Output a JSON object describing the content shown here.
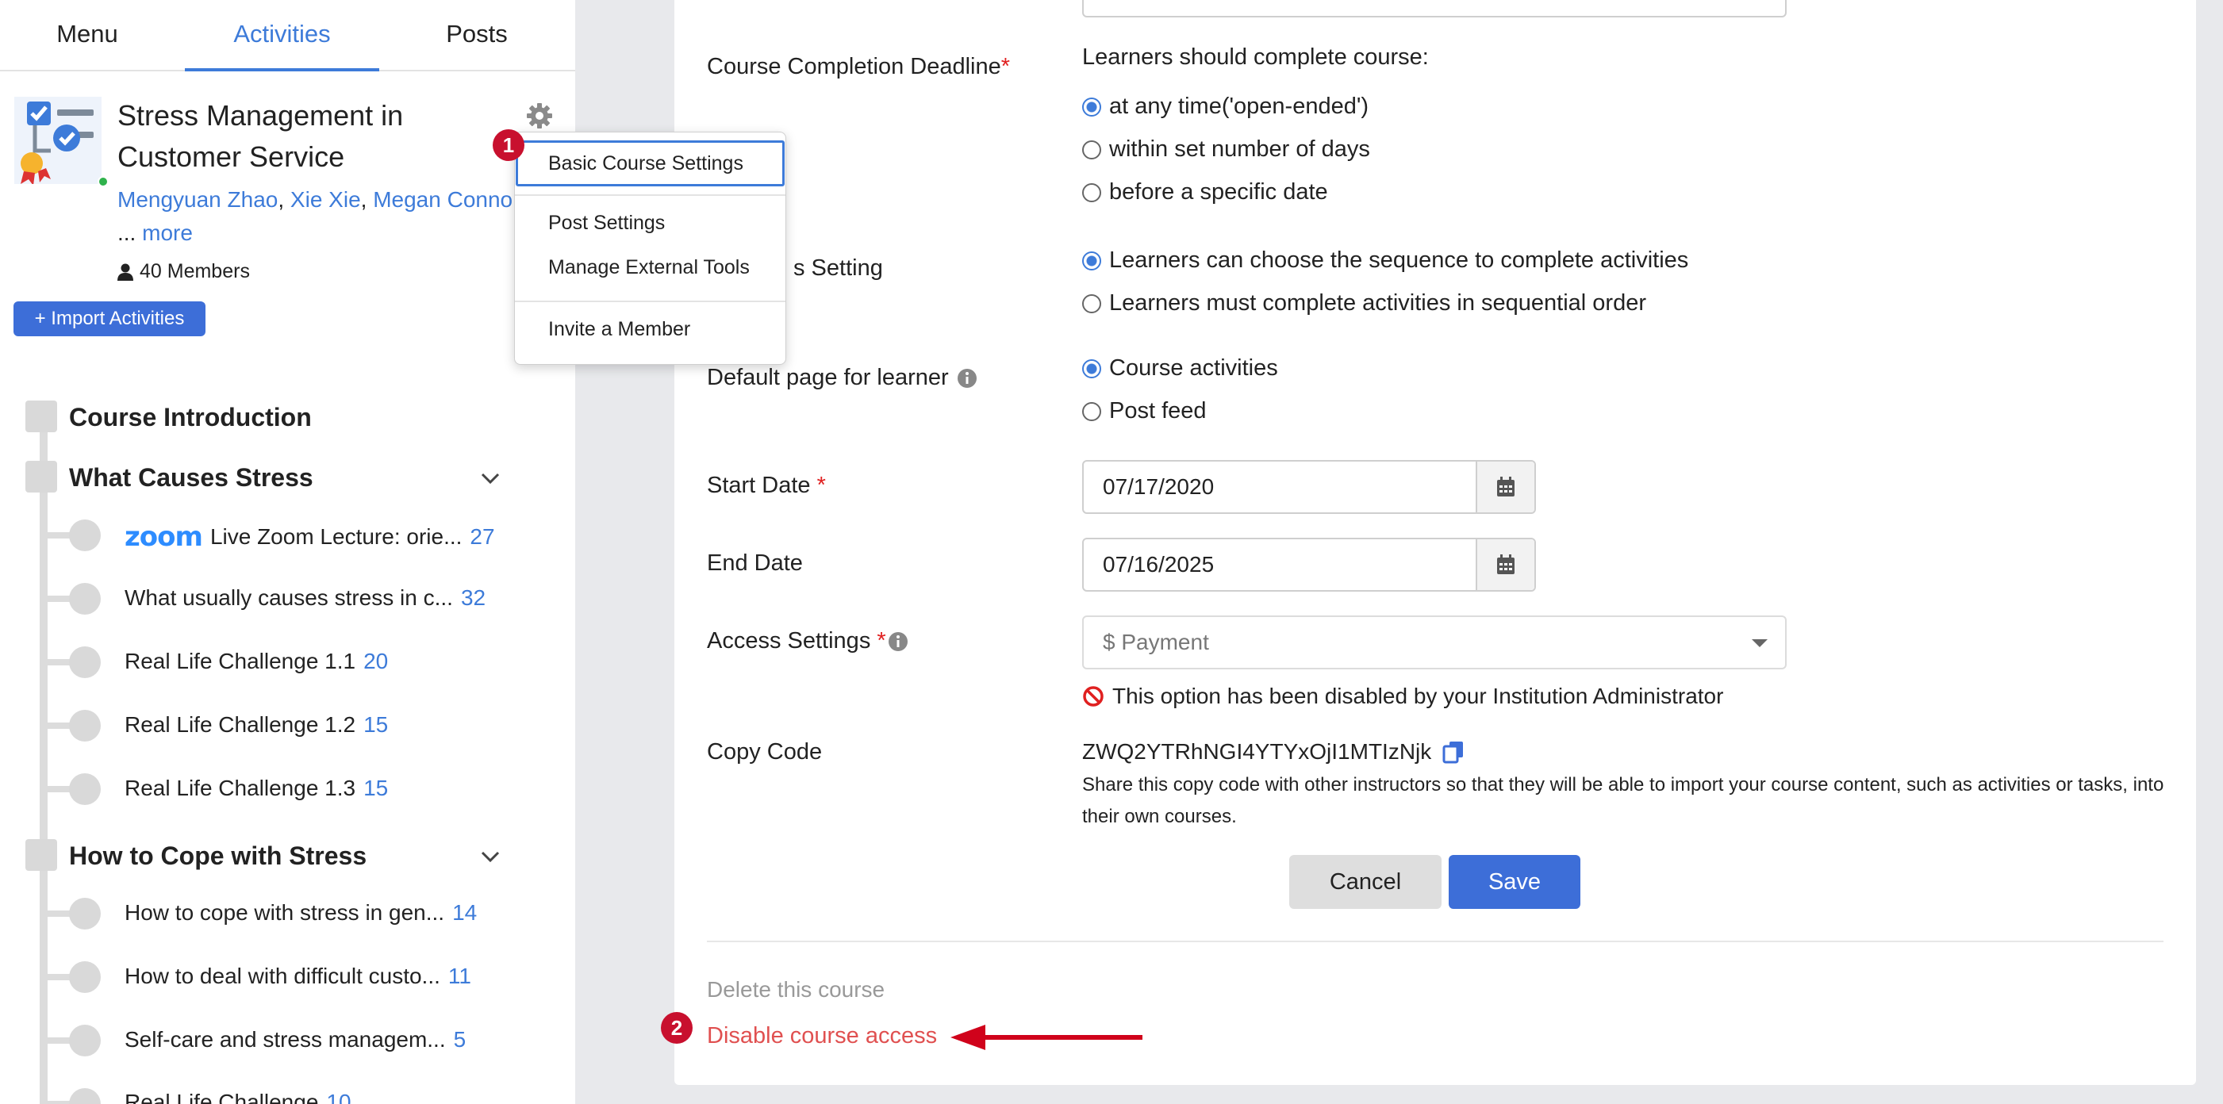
{
  "tabs": [
    {
      "label": "Menu"
    },
    {
      "label": "Activities"
    },
    {
      "label": "Posts"
    }
  ],
  "course": {
    "title": "Stress Management in Customer Service",
    "instructors": [
      "Mengyuan Zhao",
      "Xie Xie",
      "Megan Conno"
    ],
    "ellipsis": "...",
    "more_label": "more",
    "members_label": "40 Members"
  },
  "import_button": {
    "label": "+ Import Activities"
  },
  "outline": {
    "sections": [
      {
        "title": "Course Introduction"
      },
      {
        "title": "What Causes Stress"
      },
      {
        "title": "How to Cope with Stress"
      }
    ],
    "items": [
      {
        "logo": "zoom",
        "label": "Live Zoom Lecture: orie...",
        "count": "27"
      },
      {
        "label": "What usually causes stress in c...",
        "count": "32"
      },
      {
        "label": "Real Life Challenge 1.1",
        "count": "20"
      },
      {
        "label": "Real Life Challenge 1.2",
        "count": "15"
      },
      {
        "label": "Real Life Challenge 1.3",
        "count": "15"
      },
      {
        "label": "How to cope with stress in gen...",
        "count": "14"
      },
      {
        "label": "How to deal with difficult custo...",
        "count": "11"
      },
      {
        "label": "Self-care and stress managem...",
        "count": "5"
      },
      {
        "label": "Real Life Challenge",
        "count": "10"
      }
    ]
  },
  "menu": {
    "items": [
      {
        "label": "Basic Course Settings"
      },
      {
        "label": "Post Settings"
      },
      {
        "label": "Manage External Tools"
      },
      {
        "label": "Invite a Member"
      }
    ]
  },
  "badges": [
    "1",
    "2"
  ],
  "settings": {
    "completion_label": "Course Completion Deadline",
    "required_mark": "*",
    "completion_intro": "Learners should complete course:",
    "completion_options": [
      {
        "label": "at any time('open-ended')",
        "selected": true
      },
      {
        "label": "within set number of days",
        "selected": false
      },
      {
        "label": "before a specific date",
        "selected": false
      }
    ],
    "sequence_label_partial": "s Setting",
    "sequence_options": [
      {
        "label": "Learners can choose the sequence to complete activities",
        "selected": true
      },
      {
        "label": "Learners must complete activities in sequential order",
        "selected": false
      }
    ],
    "default_page_label": "Default page for learner",
    "default_page_options": [
      {
        "label": "Course activities",
        "selected": true
      },
      {
        "label": "Post feed",
        "selected": false
      }
    ],
    "start_date_label": "Start Date",
    "start_date_value": "07/17/2020",
    "end_date_label": "End Date",
    "end_date_value": "07/16/2025",
    "access_label": "Access Settings",
    "access_value": "$ Payment",
    "access_disabled_msg": "This option has been disabled by your Institution Administrator",
    "copy_code_label": "Copy Code",
    "copy_code_value": "ZWQ2YTRhNGI4YTYxOjI1MTIzNjk",
    "copy_code_desc": "Share this copy code with other instructors so that they will be able to import your course content, such as activities or tasks, into their own courses."
  },
  "buttons": {
    "cancel": "Cancel",
    "save": "Save"
  },
  "danger": {
    "delete": "Delete this course",
    "disable": "Disable course access"
  },
  "colors": {
    "accent": "#3d7bd9",
    "danger": "#e05050",
    "badge": "#c8102e",
    "arrow": "#d0021b"
  }
}
